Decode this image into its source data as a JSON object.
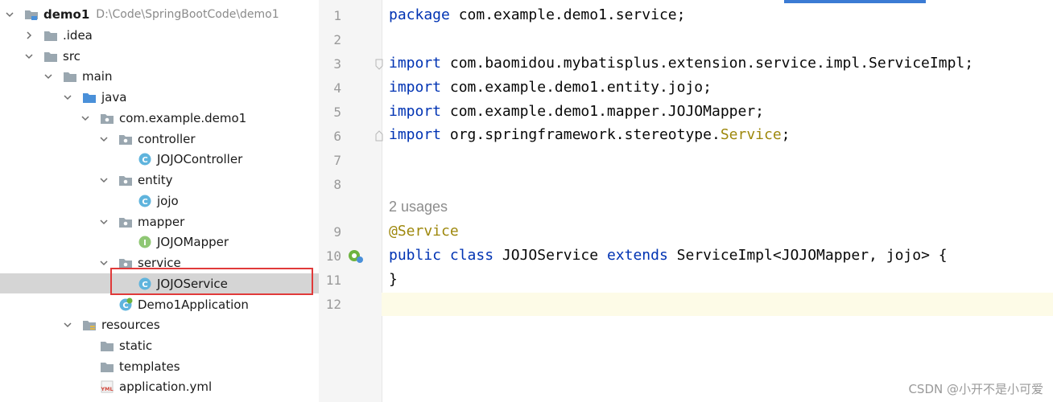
{
  "tree": {
    "items": [
      {
        "label": "demo1",
        "path": "D:\\Code\\SpringBootCode\\demo1",
        "bold": true,
        "icon": "module-folder-icon",
        "expanded": true
      },
      {
        "label": ".idea",
        "icon": "folder-icon",
        "expanded": false
      },
      {
        "label": "src",
        "icon": "folder-icon",
        "expanded": true
      },
      {
        "label": "main",
        "icon": "folder-icon",
        "expanded": true
      },
      {
        "label": "java",
        "icon": "source-folder-icon",
        "expanded": true
      },
      {
        "label": "com.example.demo1",
        "icon": "package-icon",
        "expanded": true
      },
      {
        "label": "controller",
        "icon": "package-icon",
        "expanded": true
      },
      {
        "label": "JOJOController",
        "icon": "class-icon"
      },
      {
        "label": "entity",
        "icon": "package-icon",
        "expanded": true
      },
      {
        "label": "jojo",
        "icon": "class-icon"
      },
      {
        "label": "mapper",
        "icon": "package-icon",
        "expanded": true
      },
      {
        "label": "JOJOMapper",
        "icon": "interface-icon"
      },
      {
        "label": "service",
        "icon": "package-icon",
        "expanded": true
      },
      {
        "label": "JOJOService",
        "icon": "class-icon",
        "selected": true
      },
      {
        "label": "Demo1Application",
        "icon": "spring-app-icon"
      },
      {
        "label": "resources",
        "icon": "resources-folder-icon",
        "expanded": true
      },
      {
        "label": "static",
        "icon": "folder-icon"
      },
      {
        "label": "templates",
        "icon": "folder-icon"
      },
      {
        "label": "application.yml",
        "icon": "yml-file-icon"
      }
    ]
  },
  "editor": {
    "line_numbers": [
      "1",
      "2",
      "3",
      "4",
      "5",
      "6",
      "7",
      "8",
      "9",
      "10",
      "11",
      "12"
    ],
    "usages_hint": "2 usages",
    "lines": {
      "l1": [
        "package",
        " com.example.demo1.service;"
      ],
      "l3": [
        "import",
        " com.baomidou.mybatisplus.extension.service.impl.ServiceImpl;"
      ],
      "l4": [
        "import",
        " com.example.demo1.entity.jojo;"
      ],
      "l5": [
        "import",
        " com.example.demo1.mapper.JOJOMapper;"
      ],
      "l6": [
        "import",
        " org.springframework.stereotype.",
        "Service",
        ";"
      ],
      "l9": [
        "@Service"
      ],
      "l10": [
        "public",
        " ",
        "class",
        " JOJOService ",
        "extends",
        " ServiceImpl<JOJOMapper, jojo> {"
      ],
      "l11": [
        "}"
      ]
    }
  },
  "watermark": "CSDN @小开不是小可爱",
  "colors": {
    "keyword": "#0033b3",
    "annotation": "#9e880d",
    "selection": "#d5d5d5",
    "highlight_box": "#e03a3a"
  }
}
